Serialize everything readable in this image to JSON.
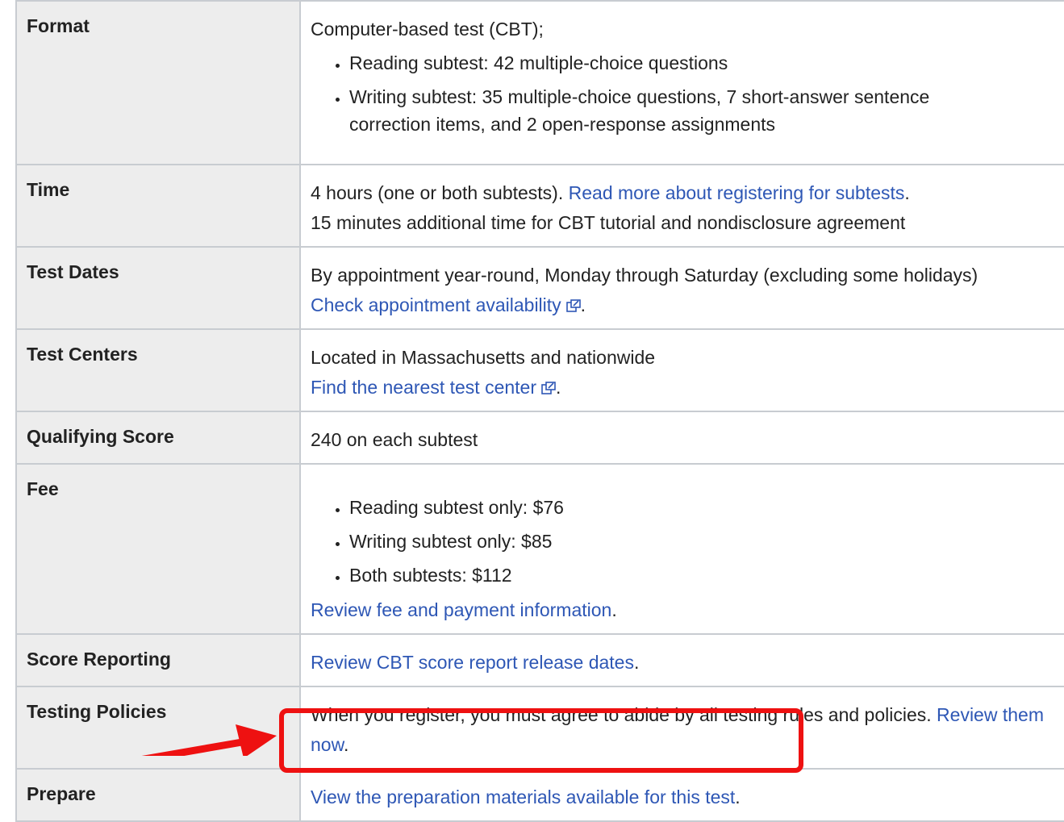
{
  "rows": {
    "format": {
      "label": "Format",
      "intro": "Computer-based test (CBT);",
      "items": [
        "Reading subtest: 42 multiple-choice questions",
        "Writing subtest: 35 multiple-choice questions, 7 short-answer sentence correction items, and 2 open-response assignments"
      ]
    },
    "time": {
      "label": "Time",
      "text": "4 hours (one or both subtests).",
      "link": "Read more about registering for subtests",
      "after": ".",
      "line2": "15 minutes additional time for CBT tutorial and nondisclosure agreement"
    },
    "test_dates": {
      "label": "Test Dates",
      "text": "By appointment year-round, Monday through Saturday (excluding some holidays)",
      "link": "Check appointment availability",
      "after": "."
    },
    "test_centers": {
      "label": "Test Centers",
      "text": "Located in Massachusetts and nationwide",
      "link": "Find the nearest test center",
      "after": "."
    },
    "qualifying_score": {
      "label": "Qualifying Score",
      "text": "240 on each subtest"
    },
    "fee": {
      "label": "Fee",
      "items": [
        "Reading subtest only: $76",
        "Writing subtest only: $85",
        "Both subtests: $112"
      ],
      "link": "Review fee and payment information",
      "after": "."
    },
    "score_reporting": {
      "label": "Score Reporting",
      "link": "Review CBT score report release dates",
      "after": "."
    },
    "testing_policies": {
      "label": "Testing Policies",
      "text": "When you register, you must agree to abide by all testing rules and policies.",
      "link": "Review them now",
      "after": "."
    },
    "prepare": {
      "label": "Prepare",
      "link": "View the preparation materials available for this test",
      "after": "."
    }
  },
  "colors": {
    "link": "#2e57b5",
    "label_bg": "#ededed",
    "border": "#c8ccd1",
    "annotation": "#ee1111"
  },
  "icons": {
    "external_link": "external-link-icon",
    "annotation_arrow": "red-arrow-annotation",
    "annotation_box": "red-highlight-box"
  }
}
